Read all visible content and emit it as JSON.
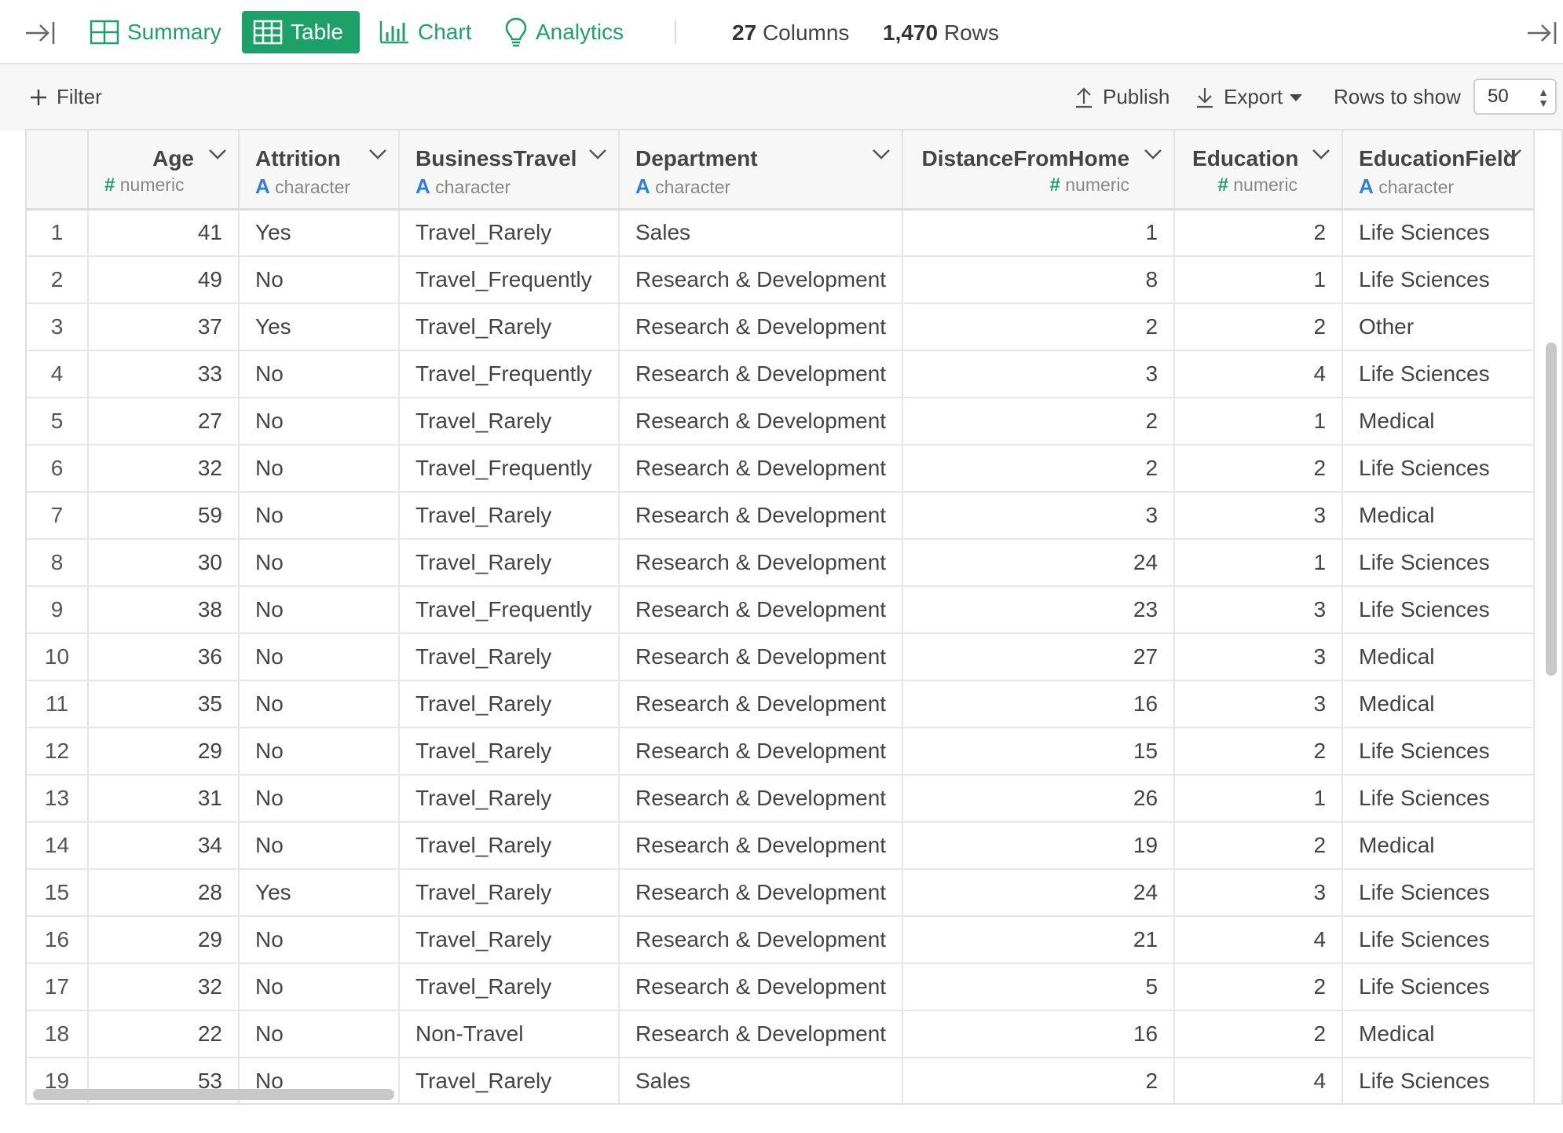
{
  "tabs": [
    {
      "label": "Summary",
      "icon": "grid-icon"
    },
    {
      "label": "Table",
      "icon": "table-icon",
      "active": true
    },
    {
      "label": "Chart",
      "icon": "bar-chart-icon"
    },
    {
      "label": "Analytics",
      "icon": "lightbulb-icon"
    }
  ],
  "stats": {
    "columns_count": "27",
    "columns_label": "Columns",
    "rows_count": "1,470",
    "rows_label": "Rows"
  },
  "toolbar": {
    "filter": "Filter",
    "publish": "Publish",
    "export": "Export",
    "rows_to_show_label": "Rows to show",
    "rows_to_show_value": "50"
  },
  "columns": [
    {
      "name": "Age",
      "type": "numeric"
    },
    {
      "name": "Attrition",
      "type": "character"
    },
    {
      "name": "BusinessTravel",
      "type": "character"
    },
    {
      "name": "Department",
      "type": "character"
    },
    {
      "name": "DistanceFromHome",
      "type": "numeric"
    },
    {
      "name": "Education",
      "type": "numeric"
    },
    {
      "name": "EducationField",
      "type": "character"
    }
  ],
  "rows": [
    [
      "1",
      "41",
      "Yes",
      "Travel_Rarely",
      "Sales",
      "1",
      "2",
      "Life Sciences"
    ],
    [
      "2",
      "49",
      "No",
      "Travel_Frequently",
      "Research & Development",
      "8",
      "1",
      "Life Sciences"
    ],
    [
      "3",
      "37",
      "Yes",
      "Travel_Rarely",
      "Research & Development",
      "2",
      "2",
      "Other"
    ],
    [
      "4",
      "33",
      "No",
      "Travel_Frequently",
      "Research & Development",
      "3",
      "4",
      "Life Sciences"
    ],
    [
      "5",
      "27",
      "No",
      "Travel_Rarely",
      "Research & Development",
      "2",
      "1",
      "Medical"
    ],
    [
      "6",
      "32",
      "No",
      "Travel_Frequently",
      "Research & Development",
      "2",
      "2",
      "Life Sciences"
    ],
    [
      "7",
      "59",
      "No",
      "Travel_Rarely",
      "Research & Development",
      "3",
      "3",
      "Medical"
    ],
    [
      "8",
      "30",
      "No",
      "Travel_Rarely",
      "Research & Development",
      "24",
      "1",
      "Life Sciences"
    ],
    [
      "9",
      "38",
      "No",
      "Travel_Frequently",
      "Research & Development",
      "23",
      "3",
      "Life Sciences"
    ],
    [
      "10",
      "36",
      "No",
      "Travel_Rarely",
      "Research & Development",
      "27",
      "3",
      "Medical"
    ],
    [
      "11",
      "35",
      "No",
      "Travel_Rarely",
      "Research & Development",
      "16",
      "3",
      "Medical"
    ],
    [
      "12",
      "29",
      "No",
      "Travel_Rarely",
      "Research & Development",
      "15",
      "2",
      "Life Sciences"
    ],
    [
      "13",
      "31",
      "No",
      "Travel_Rarely",
      "Research & Development",
      "26",
      "1",
      "Life Sciences"
    ],
    [
      "14",
      "34",
      "No",
      "Travel_Rarely",
      "Research & Development",
      "19",
      "2",
      "Medical"
    ],
    [
      "15",
      "28",
      "Yes",
      "Travel_Rarely",
      "Research & Development",
      "24",
      "3",
      "Life Sciences"
    ],
    [
      "16",
      "29",
      "No",
      "Travel_Rarely",
      "Research & Development",
      "21",
      "4",
      "Life Sciences"
    ],
    [
      "17",
      "32",
      "No",
      "Travel_Rarely",
      "Research & Development",
      "5",
      "2",
      "Life Sciences"
    ],
    [
      "18",
      "22",
      "No",
      "Non-Travel",
      "Research & Development",
      "16",
      "2",
      "Medical"
    ],
    [
      "19",
      "53",
      "No",
      "Travel_Rarely",
      "Sales",
      "2",
      "4",
      "Life Sciences"
    ]
  ],
  "colors": {
    "accent": "#1ea168",
    "character_type": "#2f7fd8"
  }
}
